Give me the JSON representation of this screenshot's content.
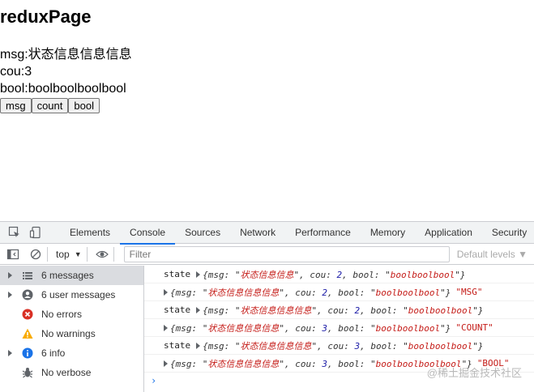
{
  "page": {
    "title": "reduxPage",
    "msg_line": "msg:状态信息信息信息",
    "cou_line": "cou:3",
    "bool_line": "bool:boolboolboolbool",
    "buttons": {
      "msg": "msg",
      "count": "count",
      "bool": "bool"
    }
  },
  "devtools": {
    "tabs": [
      "Elements",
      "Console",
      "Sources",
      "Network",
      "Performance",
      "Memory",
      "Application",
      "Security"
    ],
    "active_tab": "Console",
    "toolbar": {
      "context": "top",
      "filter_placeholder": "Filter",
      "levels": "Default levels"
    },
    "sidebar": [
      {
        "label": "6 messages",
        "icon": "list-icon",
        "expandable": true,
        "selected": true
      },
      {
        "label": "6 user messages",
        "icon": "user-icon",
        "expandable": true,
        "selected": false
      },
      {
        "label": "No errors",
        "icon": "error-icon",
        "expandable": false,
        "selected": false
      },
      {
        "label": "No warnings",
        "icon": "warning-icon",
        "expandable": false,
        "selected": false
      },
      {
        "label": "6 info",
        "icon": "info-icon",
        "expandable": true,
        "selected": false
      },
      {
        "label": "No verbose",
        "icon": "bug-icon",
        "expandable": false,
        "selected": false
      }
    ],
    "console": [
      {
        "prefix": "state",
        "msg": "状态信息信息",
        "cou": "2",
        "bool": "boolboolbool",
        "tag": ""
      },
      {
        "prefix": "",
        "msg": "状态信息信息信息",
        "cou": "2",
        "bool": "boolboolbool",
        "tag": "\"MSG\""
      },
      {
        "prefix": "state",
        "msg": "状态信息信息信息",
        "cou": "2",
        "bool": "boolboolbool",
        "tag": ""
      },
      {
        "prefix": "",
        "msg": "状态信息信息信息",
        "cou": "3",
        "bool": "boolboolbool",
        "tag": "\"COUNT\""
      },
      {
        "prefix": "state",
        "msg": "状态信息信息信息",
        "cou": "3",
        "bool": "boolboolbool",
        "tag": ""
      },
      {
        "prefix": "",
        "msg": "状态信息信息信息",
        "cou": "3",
        "bool": "boolboolboolbool",
        "tag": "\"BOOL\""
      }
    ],
    "prompt": "›",
    "watermark": "@稀土掘金技术社区"
  },
  "colors": {
    "accent": "#1a73e8",
    "string": "#c41a16",
    "number": "#1a1aa6",
    "error": "#d93025",
    "warning": "#f9ab00"
  }
}
